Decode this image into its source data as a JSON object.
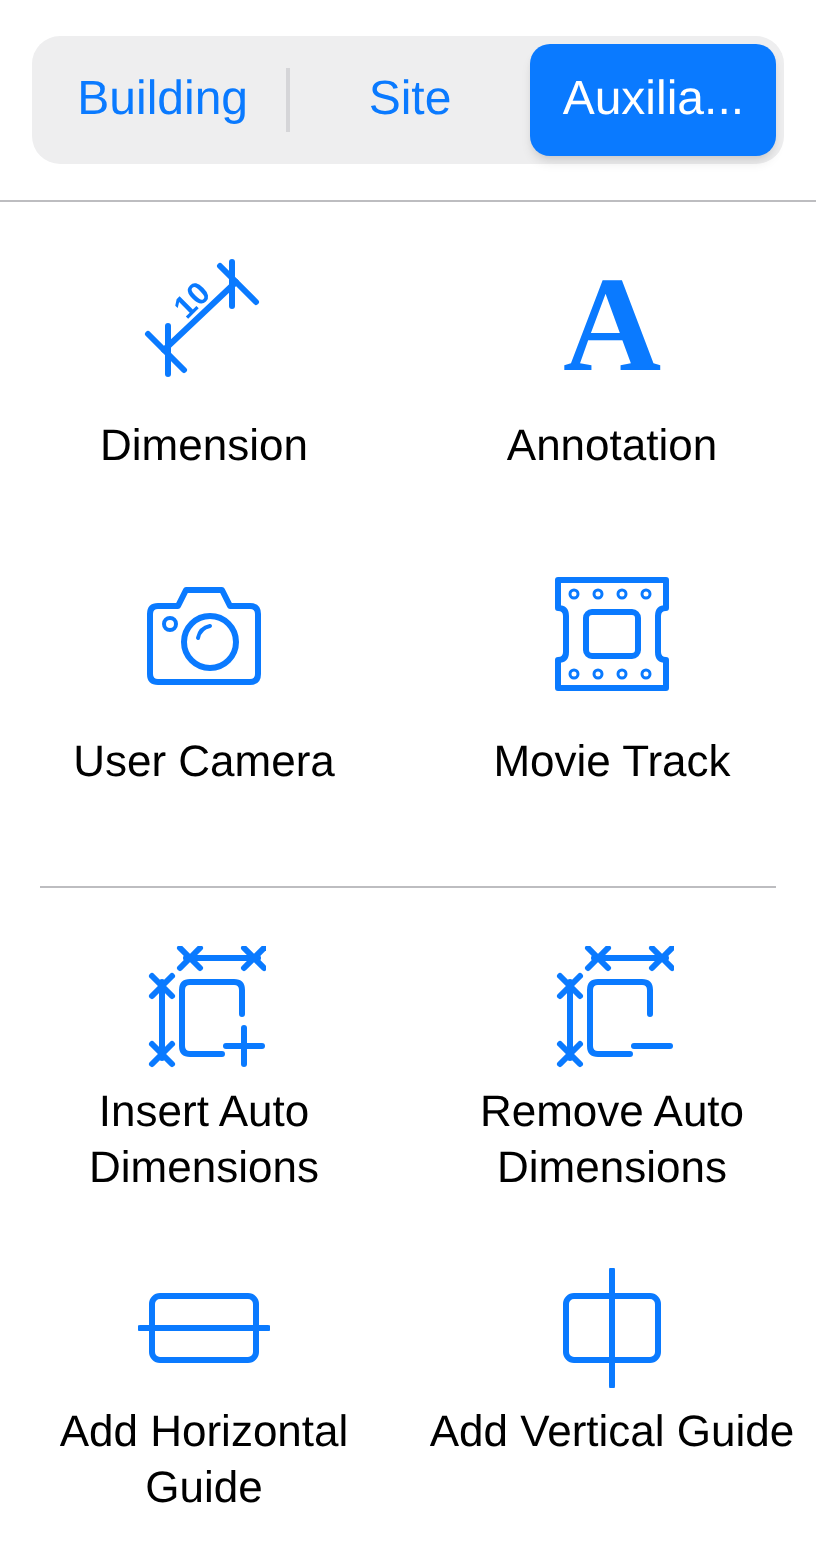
{
  "segments": [
    {
      "label": "Building",
      "selected": false
    },
    {
      "label": "Site",
      "selected": false
    },
    {
      "label": "Auxilia...",
      "selected": true
    }
  ],
  "sections": [
    {
      "items": [
        {
          "kind": "dimension",
          "label": "Dimension",
          "icon_text": "10"
        },
        {
          "kind": "annotation",
          "label": "Annotation",
          "icon_text": "A"
        },
        {
          "kind": "camera",
          "label": "User Camera"
        },
        {
          "kind": "film",
          "label": "Movie Track"
        }
      ]
    },
    {
      "items": [
        {
          "kind": "insert-dims",
          "label": "Insert Auto Dimensions"
        },
        {
          "kind": "remove-dims",
          "label": "Remove Auto Dimensions"
        },
        {
          "kind": "h-guide",
          "label": "Add Horizontal Guide"
        },
        {
          "kind": "v-guide",
          "label": "Add Vertical Guide"
        }
      ]
    }
  ]
}
